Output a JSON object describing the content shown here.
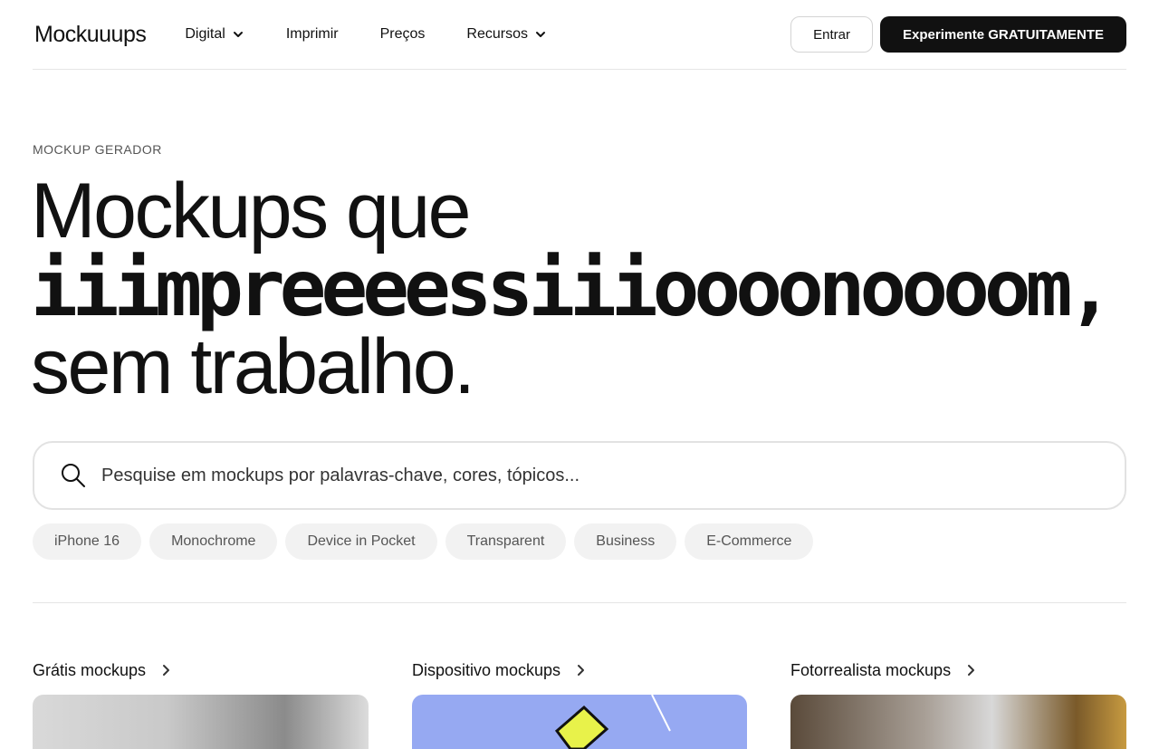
{
  "header": {
    "logo": "Mockuuups",
    "nav": [
      {
        "label": "Digital",
        "has_dropdown": true
      },
      {
        "label": "Imprimir",
        "has_dropdown": false
      },
      {
        "label": "Preços",
        "has_dropdown": false
      },
      {
        "label": "Recursos",
        "has_dropdown": true
      }
    ],
    "login_label": "Entrar",
    "cta_label": "Experimente GRATUITAMENTE"
  },
  "hero": {
    "eyebrow": "MOCKUP GERADOR",
    "title_line1": "Mockups que",
    "title_line2": "iiimpreeeessiiioooonoooom,",
    "title_line3": "sem trabalho."
  },
  "search": {
    "placeholder": "Pesquise em mockups por palavras-chave, cores, tópicos..."
  },
  "chips": [
    "iPhone 16",
    "Monochrome",
    "Device in Pocket",
    "Transparent",
    "Business",
    "E-Commerce"
  ],
  "categories": [
    {
      "title": "Grátis mockups"
    },
    {
      "title": "Dispositivo mockups"
    },
    {
      "title": "Fotorrealista mockups"
    }
  ],
  "colors": {
    "text": "#111111",
    "cta_bg": "#111111",
    "chip_bg": "#f2f2f2",
    "border": "#e5e5e5"
  }
}
